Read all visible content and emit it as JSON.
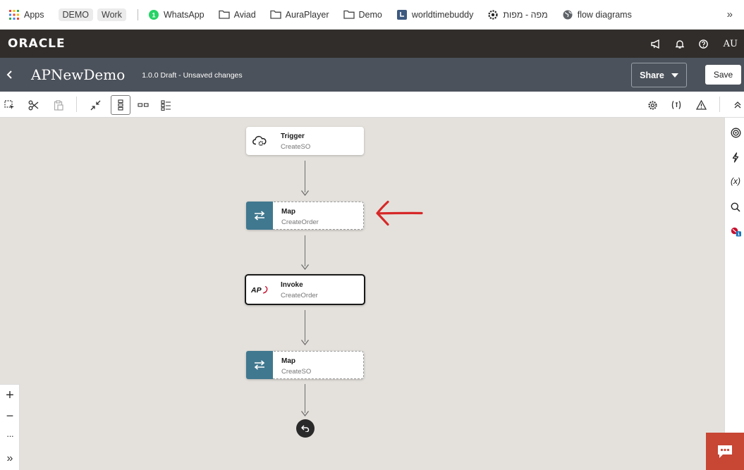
{
  "bookmarks": {
    "apps": "Apps",
    "chip1": "DEMO",
    "chip2": "Work",
    "items": [
      "WhatsApp",
      "Aviad",
      "AuraPlayer",
      "Demo",
      "worldtimebuddy",
      "מפה - מפות",
      "flow diagrams"
    ],
    "whatsapp_badge": "1"
  },
  "header": {
    "logo": "ORACLE",
    "user_initials": "AU"
  },
  "titlebar": {
    "integration_name": "APNewDemo",
    "status": "1.0.0 Draft - Unsaved changes",
    "share_label": "Share",
    "save_label": "Save"
  },
  "flow": {
    "nodes": [
      {
        "title": "Trigger",
        "subtitle": "CreateSO"
      },
      {
        "title": "Map",
        "subtitle": "CreateOrder"
      },
      {
        "title": "Invoke",
        "subtitle": "CreateOrder",
        "icon_text": "AP"
      },
      {
        "title": "Map",
        "subtitle": "CreateSO"
      }
    ]
  },
  "rail": {
    "variables_label": "(x)",
    "error_badge": "1"
  },
  "zoom": {
    "in": "+",
    "out": "−",
    "more": "···",
    "expand": "»"
  },
  "colors": {
    "map_accent": "#40788f",
    "header_bg": "#312d2a",
    "titlebar_bg": "#4c525b",
    "annotation_arrow": "#d62828",
    "chat_button": "#c74634"
  }
}
